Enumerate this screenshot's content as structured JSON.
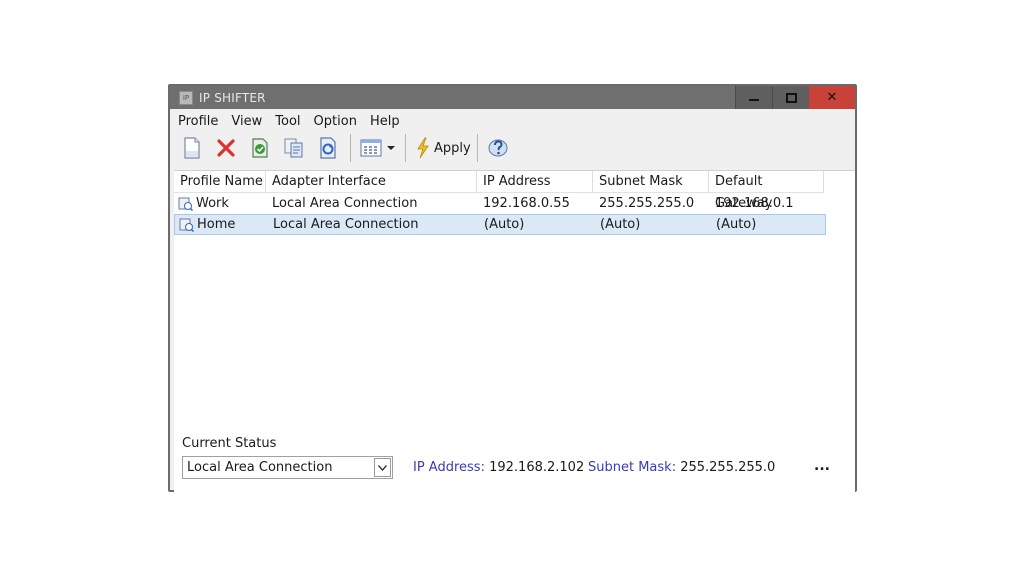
{
  "window": {
    "title": "IP SHIFTER",
    "app_icon_glyph": "IP",
    "controls": {
      "minimize": "▁",
      "maximize": "□",
      "close": "✕"
    }
  },
  "menu": [
    "Profile",
    "View",
    "Tool",
    "Option",
    "Help"
  ],
  "toolbar": {
    "items": [
      "new-profile-icon",
      "delete-icon",
      "save-check-icon",
      "copy-icon",
      "refresh-icon",
      "view-grid-icon",
      "dropdown-arrow-icon"
    ],
    "apply_label": "Apply",
    "help_icon": "help-icon"
  },
  "table": {
    "columns": [
      "Profile Name",
      "Adapter Interface",
      "IP Address",
      "Subnet Mask",
      "Default Gateway"
    ],
    "rows": [
      {
        "name": "Work",
        "adapter": "Local Area Connection",
        "ip": "192.168.0.55",
        "mask": "255.255.255.0",
        "gateway": "192.168.0.1",
        "selected": false
      },
      {
        "name": "Home",
        "adapter": "Local Area Connection",
        "ip": "(Auto)",
        "mask": "(Auto)",
        "gateway": "(Auto)",
        "selected": true
      }
    ]
  },
  "status": {
    "label": "Current Status",
    "adapter": "Local Area Connection",
    "ip_key": "IP Address:",
    "ip_value": "192.168.2.102",
    "mask_key": "Subnet Mask:",
    "mask_value": "255.255.255.0",
    "more": "..."
  },
  "colors": {
    "titlebar": "#6f6f6f",
    "close": "#c9423a",
    "selection": "#dbe9f7",
    "status_key": "#3a3ab8"
  }
}
